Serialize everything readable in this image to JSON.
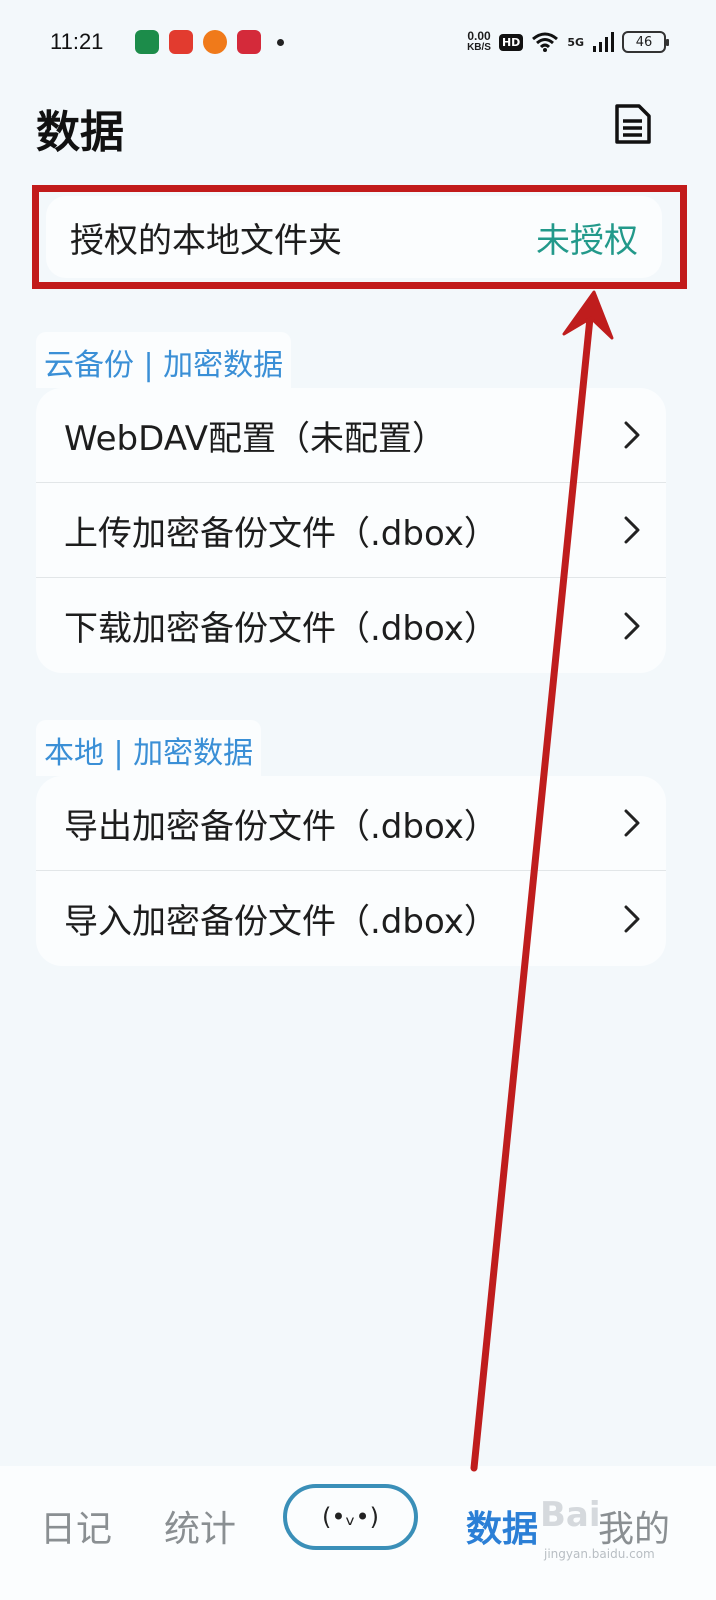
{
  "status_bar": {
    "time": "11:21",
    "net_speed_value": "0.00",
    "net_speed_unit": "KB/S",
    "hd_badge": "HD",
    "signal_label": "5G",
    "battery": "46"
  },
  "header": {
    "title": "数据",
    "doc_icon": "document-list-icon"
  },
  "auth": {
    "label": "授权的本地文件夹",
    "status": "未授权",
    "status_color": "#22998a",
    "highlight_color": "#c21b1b"
  },
  "cloud_section": {
    "title": "云备份 | 加密数据",
    "items": [
      {
        "label": "WebDAV配置（未配置）"
      },
      {
        "label": "上传加密备份文件（.dbox）"
      },
      {
        "label": "下载加密备份文件（.dbox）"
      }
    ]
  },
  "local_section": {
    "title": "本地 | 加密数据",
    "items": [
      {
        "label": "导出加密备份文件（.dbox）"
      },
      {
        "label": "导入加密备份文件（.dbox）"
      }
    ]
  },
  "bottom_nav": {
    "items": [
      {
        "label": "日记",
        "active": false
      },
      {
        "label": "统计",
        "active": false
      },
      {
        "label": "(•ᵥ•)",
        "active": false
      },
      {
        "label": "数据",
        "active": true
      },
      {
        "label": "我的",
        "active": false
      }
    ],
    "active_color": "#2b7fd6"
  },
  "watermark": {
    "brand": "Bai",
    "url": "jingyan.baidu.com"
  }
}
